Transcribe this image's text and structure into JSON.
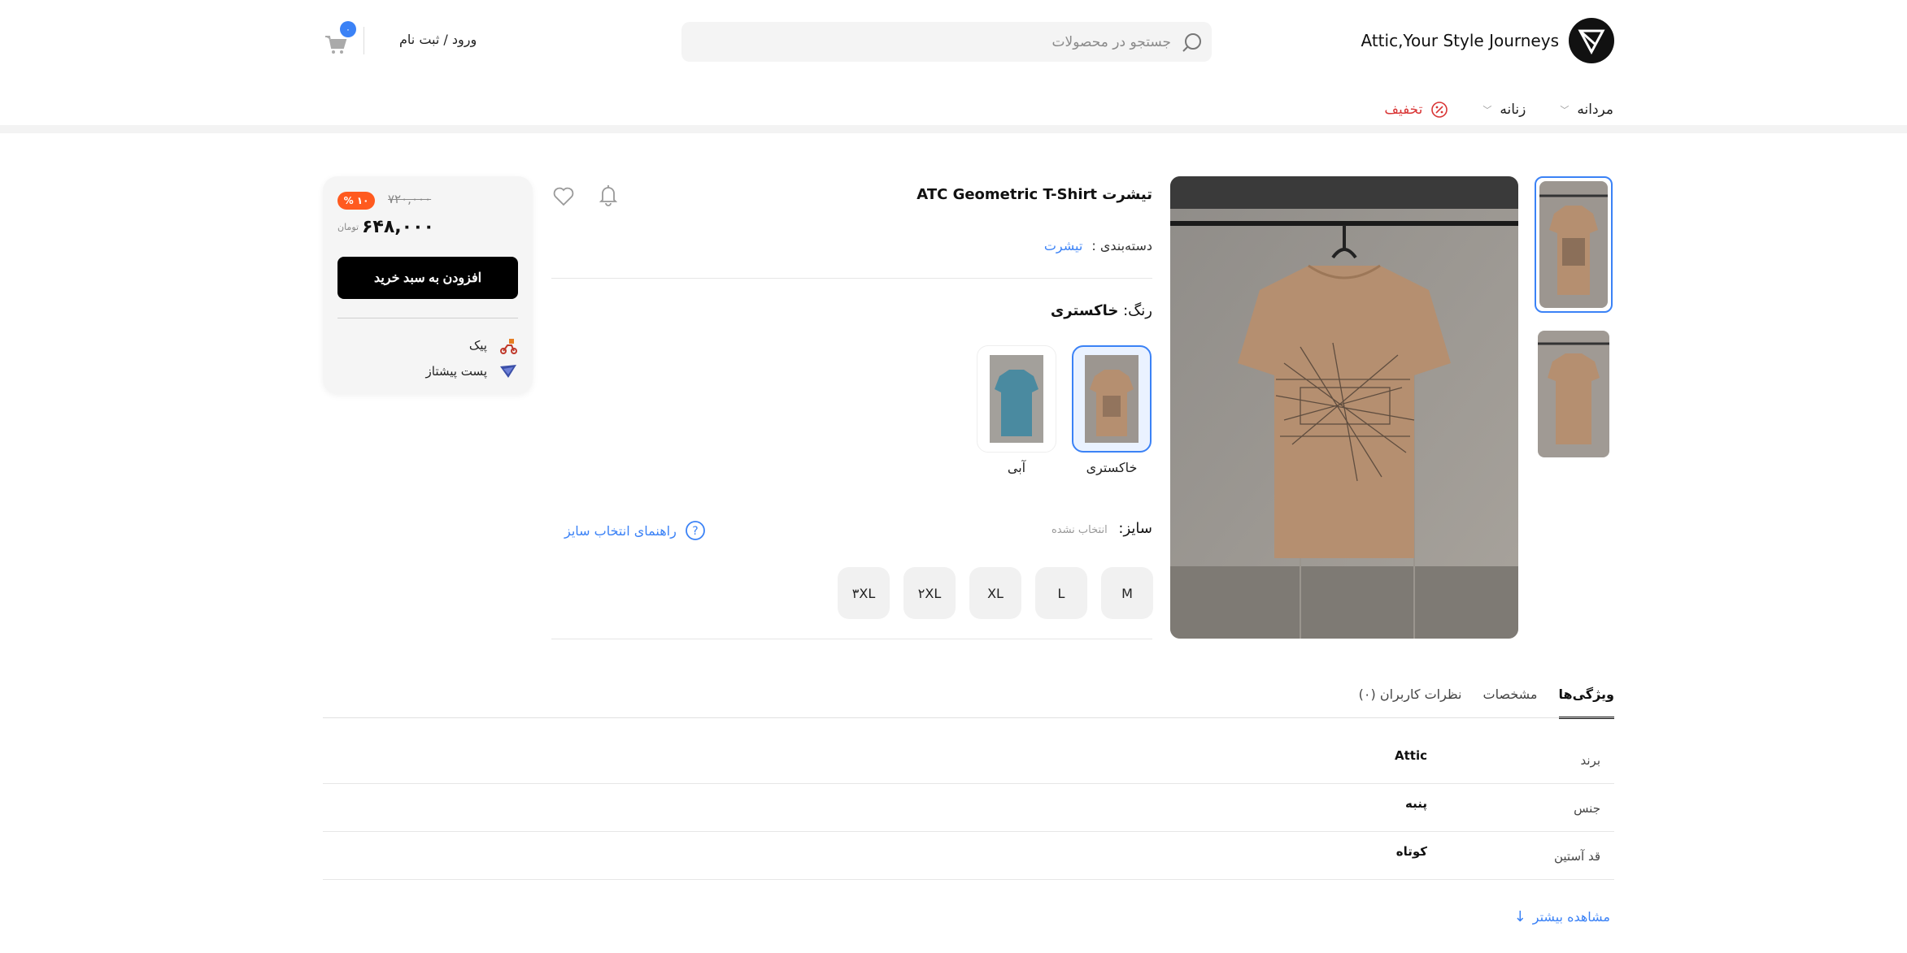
{
  "header": {
    "brand_name": "Attic,Your Style Journeys",
    "search_placeholder": "جستجو در محصولات",
    "login_label": "ورود / ثبت نام",
    "cart_count": "۰"
  },
  "nav": {
    "items": [
      {
        "label": "مردانه"
      },
      {
        "label": "زنانه"
      },
      {
        "label": "تخفیف"
      }
    ]
  },
  "product": {
    "title": "تیشرت ATC Geometric T-Shirt",
    "category_label": "دسته‌بندی :",
    "category_value": "تیشرت",
    "color_label": "رنگ:",
    "color_value": "خاکستری",
    "colors": [
      {
        "label": "خاکستری",
        "hex": "#b58f70"
      },
      {
        "label": "آبی",
        "hex": "#4a8aa0"
      }
    ],
    "size_label": "سایز:",
    "size_status": "انتخاب نشده",
    "size_guide": "راهنمای انتخاب سایز",
    "sizes": [
      "M",
      "L",
      "XL",
      "۲XL",
      "۳XL"
    ]
  },
  "price_card": {
    "old_price": "۷۲۰,۰۰۰",
    "discount": "۱۰ %",
    "new_price": "۶۴۸,۰۰۰",
    "currency": "تومان",
    "add_to_cart": "افزودن به سبد خرید",
    "shipping": [
      {
        "label": "پیک",
        "icon": "scooter-icon"
      },
      {
        "label": "پست پیشتاز",
        "icon": "post-icon"
      }
    ]
  },
  "tabs": [
    {
      "label": "ویژگی‌ها"
    },
    {
      "label": "مشخصات"
    },
    {
      "label": "نظرات کاربران (۰)"
    }
  ],
  "specs": [
    {
      "key": "برند",
      "value": "Attic"
    },
    {
      "key": "جنس",
      "value": "پنبه"
    },
    {
      "key": "قد آستین",
      "value": "کوتاه"
    }
  ],
  "see_more": "مشاهده بیشتر",
  "colors": {
    "accent": "#3b82f6",
    "discount": "#ff5a1f",
    "sale_red": "#d93636"
  }
}
